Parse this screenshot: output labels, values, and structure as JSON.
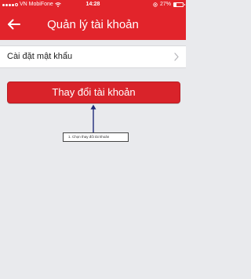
{
  "status_bar": {
    "carrier": "VN MobiFone",
    "time": "14:28",
    "battery": "27%",
    "battery_level": 0.27,
    "signal_bars_filled": 4,
    "signal_bars_total": 5
  },
  "navbar": {
    "title": "Quản lý tài khoản",
    "back_icon": "arrow-left-icon"
  },
  "settings": {
    "password_row_label": "Cài đặt mật khẩu",
    "chevron_icon": "chevron-right-icon"
  },
  "primary_action": {
    "label": "Thay đổi tài khoản"
  },
  "annotation": {
    "text": "1. Chọn thay đổi tài khoản"
  },
  "colors": {
    "brand_red": "#e2242b",
    "background": "#e9eaed",
    "annotation_arrow": "#1f2a7a"
  }
}
